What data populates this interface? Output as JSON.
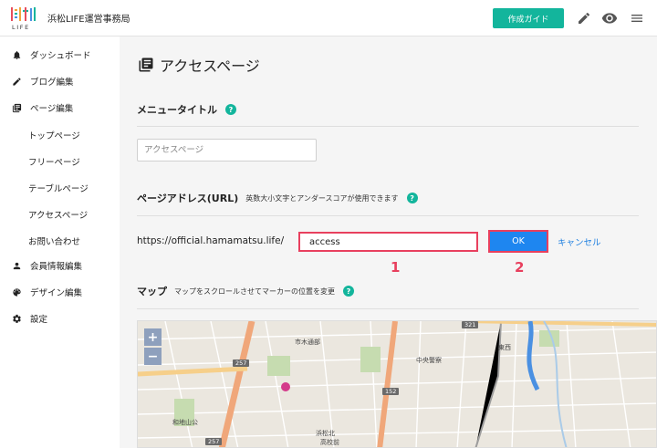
{
  "header": {
    "org_name": "浜松LIFE運営事務局",
    "guide_button": "作成ガイド",
    "icons": [
      "pencil-icon",
      "eye-icon",
      "menu-icon"
    ]
  },
  "sidebar": {
    "items": [
      {
        "label": "ダッシュボード",
        "icon": "bell-icon"
      },
      {
        "label": "ブログ編集",
        "icon": "pencil-icon"
      },
      {
        "label": "ページ編集",
        "icon": "pages-icon"
      },
      {
        "label": "会員情報編集",
        "icon": "person-icon"
      },
      {
        "label": "デザイン編集",
        "icon": "palette-icon"
      },
      {
        "label": "設定",
        "icon": "gear-icon"
      }
    ],
    "subitems": [
      "トップページ",
      "フリーページ",
      "テーブルページ",
      "アクセスページ",
      "お問い合わせ"
    ]
  },
  "main": {
    "page_title": "アクセスページ",
    "menu_title": {
      "label": "メニュータイトル",
      "placeholder": "アクセスページ"
    },
    "page_address": {
      "label": "ページアドレス(URL)",
      "hint": "英数大小文字とアンダースコアが使用できます",
      "prefix": "https://official.hamamatsu.life/",
      "value": "access",
      "ok_label": "OK",
      "cancel_label": "キャンセル"
    },
    "callouts": [
      "1",
      "2"
    ],
    "map_section": {
      "label": "マップ",
      "hint": "マップをスクロールさせてマーカーの位置を変更",
      "zoom_in": "+",
      "zoom_out": "−",
      "labels": [
        "市木通部",
        "中央警察",
        "東西",
        "和地山公",
        "浜松北",
        "高校前"
      ],
      "road_numbers": [
        "257",
        "152",
        "321",
        "257"
      ]
    }
  },
  "colors": {
    "accent": "#13b59c",
    "primary": "#1e86f0",
    "highlight": "#e8405e",
    "link": "#1e7fe0"
  }
}
